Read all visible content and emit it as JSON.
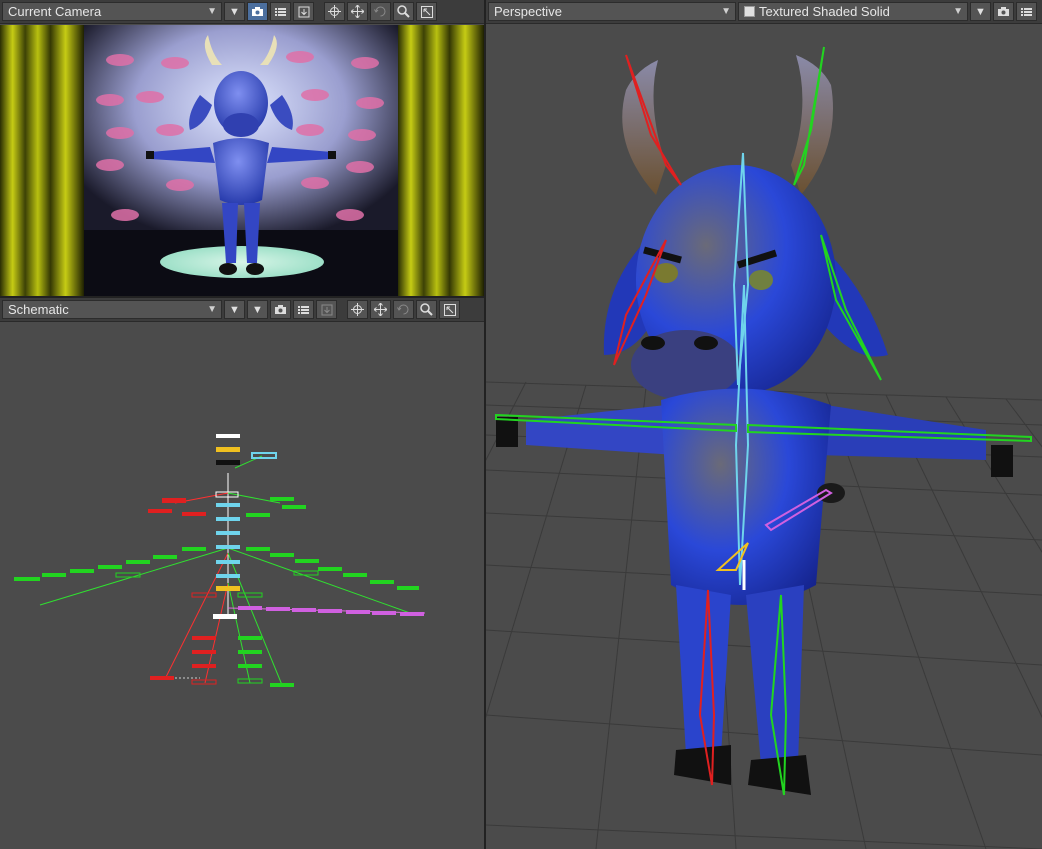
{
  "viewports": {
    "camera": {
      "view_label": "Current Camera",
      "icons": [
        "caret-down-icon",
        "camera-icon",
        "list-icon",
        "render-icon",
        "move-icon",
        "pan-icon",
        "rotate-icon",
        "zoom-icon",
        "maximize-icon"
      ]
    },
    "schematic": {
      "view_label": "Schematic",
      "icons": [
        "caret-down-icon",
        "camera-icon",
        "list-icon",
        "render-icon",
        "move-icon",
        "pan-icon",
        "rotate-icon",
        "zoom-icon",
        "maximize-icon"
      ]
    },
    "perspective": {
      "view_label": "Perspective",
      "shading_label": "Textured Shaded Solid",
      "icons": [
        "caret-down-icon",
        "camera-icon",
        "list-icon"
      ]
    }
  },
  "colors": {
    "active_button": "#4c6f9e",
    "bone_green": "#22d420",
    "bone_red": "#e02020",
    "bone_cyan": "#6fd4ec",
    "bone_magenta": "#d060e0",
    "bone_yellow": "#f0c020",
    "viewport_bg": "#4b4b4b",
    "curtain": "#b8c010",
    "bull_body": "#2a48d8"
  }
}
